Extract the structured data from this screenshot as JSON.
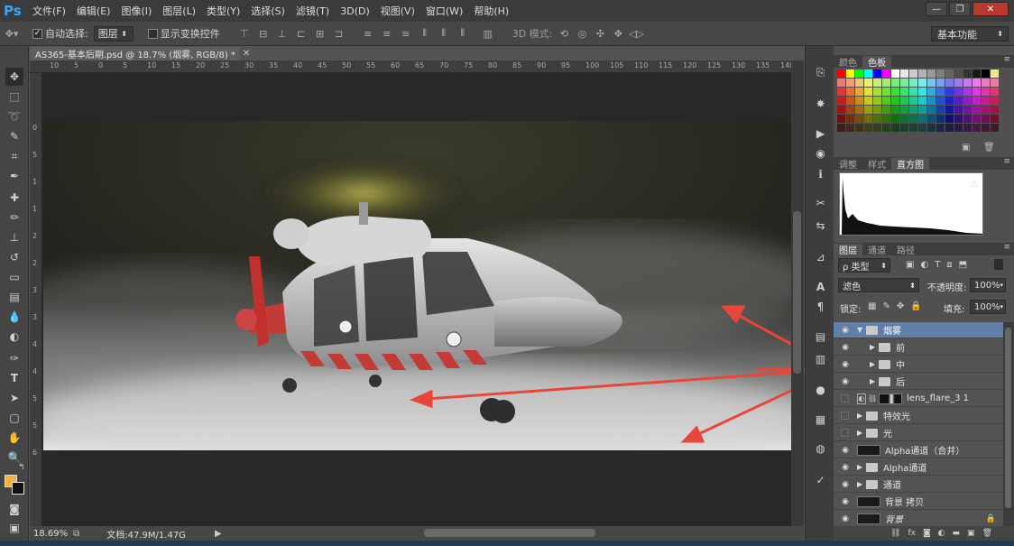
{
  "app": {
    "logo": "Ps",
    "menu": [
      "文件(F)",
      "编辑(E)",
      "图像(I)",
      "图层(L)",
      "类型(Y)",
      "选择(S)",
      "滤镜(T)",
      "3D(D)",
      "视图(V)",
      "窗口(W)",
      "帮助(H)"
    ],
    "window_buttons": [
      "—",
      "❐",
      "✕"
    ]
  },
  "options": {
    "auto_select_label": "自动选择:",
    "auto_select_value": "图层",
    "show_transform_label": "显示变换控件",
    "mode_3d_label": "3D 模式:",
    "workspace": "基本功能"
  },
  "document": {
    "tab_title": "AS365-基本后期.psd @ 18.7% (烟雾, RGB/8) *",
    "zoom": "18.69%",
    "doc_size": "文档:47.9M/1.47G",
    "ruler_h": [
      "10",
      "5",
      "0",
      "5",
      "10",
      "15",
      "20",
      "25",
      "30",
      "35",
      "40",
      "45",
      "50",
      "55",
      "60",
      "65",
      "70",
      "75",
      "80",
      "85",
      "90",
      "95",
      "100",
      "105",
      "110",
      "115",
      "120",
      "125",
      "130",
      "135",
      "140",
      "145"
    ],
    "ruler_v": [
      "0",
      "5",
      "1",
      "1",
      "2",
      "2",
      "3",
      "3",
      "4",
      "4",
      "5",
      "5",
      "6"
    ]
  },
  "panels": {
    "top_tabs": [
      "颜色",
      "色板"
    ],
    "mid_tabs": [
      "调整",
      "样式",
      "直方图"
    ],
    "layer_tabs": [
      "图层",
      "通道",
      "路径"
    ],
    "filter_kind": "ρ 类型",
    "blend_mode": "滤色",
    "opacity_label": "不透明度:",
    "opacity_value": "100%",
    "lock_label": "锁定:",
    "fill_label": "填充:",
    "fill_value": "100%",
    "warning_icon": "⚠",
    "layers": [
      {
        "name": "烟雾",
        "kind": "folder-open",
        "visible": true,
        "selected": true,
        "indent": 0
      },
      {
        "name": "前",
        "kind": "folder",
        "visible": true,
        "selected": false,
        "indent": 1
      },
      {
        "name": "中",
        "kind": "folder",
        "visible": true,
        "selected": false,
        "indent": 1
      },
      {
        "name": "后",
        "kind": "folder",
        "visible": true,
        "selected": false,
        "indent": 1
      },
      {
        "name": "lens_flare_3 1",
        "kind": "layer-mask",
        "visible": false,
        "selected": false,
        "indent": 0
      },
      {
        "name": "特效光",
        "kind": "folder",
        "visible": false,
        "selected": false,
        "indent": 0
      },
      {
        "name": "光",
        "kind": "folder",
        "visible": false,
        "selected": false,
        "indent": 0
      },
      {
        "name": "Alpha通道（合并）",
        "kind": "layer",
        "visible": true,
        "selected": false,
        "indent": 0
      },
      {
        "name": "Alpha通道",
        "kind": "folder",
        "visible": true,
        "selected": false,
        "indent": 0
      },
      {
        "name": "通道",
        "kind": "folder",
        "visible": true,
        "selected": false,
        "indent": 0
      },
      {
        "name": "背景 拷贝",
        "kind": "layer",
        "visible": true,
        "selected": false,
        "indent": 0
      },
      {
        "name": "背景",
        "kind": "layer-locked",
        "visible": true,
        "selected": false,
        "indent": 0
      }
    ]
  },
  "colors": {
    "fg": "#f5b041",
    "bg": "#111111",
    "selection": "#5f7ea8",
    "arrow": "#e8463b"
  }
}
